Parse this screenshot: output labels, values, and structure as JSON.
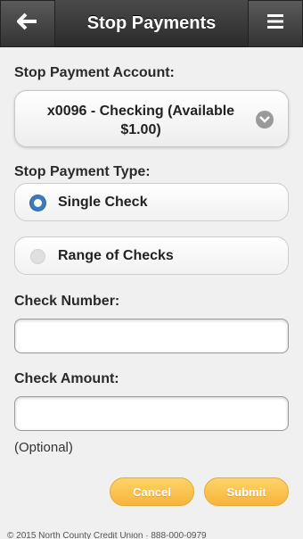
{
  "header": {
    "title": "Stop Payments",
    "back_icon": "arrow-left-icon",
    "menu_icon": "hamburger-icon"
  },
  "form": {
    "account_label": "Stop Payment Account:",
    "account_value": "x0096 - Checking (Available $1.00)",
    "type_label": "Stop Payment Type:",
    "type_options": [
      {
        "label": "Single Check",
        "selected": true
      },
      {
        "label": "Range of Checks",
        "selected": false
      }
    ],
    "check_number_label": "Check Number:",
    "check_number_value": "",
    "check_amount_label": "Check Amount:",
    "check_amount_value": "",
    "optional_note": "(Optional)"
  },
  "buttons": {
    "cancel": "Cancel",
    "submit": "Submit"
  },
  "footer": {
    "text": "© 2015 North County Credit Union · 888-000-0979"
  },
  "colors": {
    "header_bg": "#333333",
    "radio_selected": "#3b7bbd",
    "button_bg": "#f9c04a"
  }
}
